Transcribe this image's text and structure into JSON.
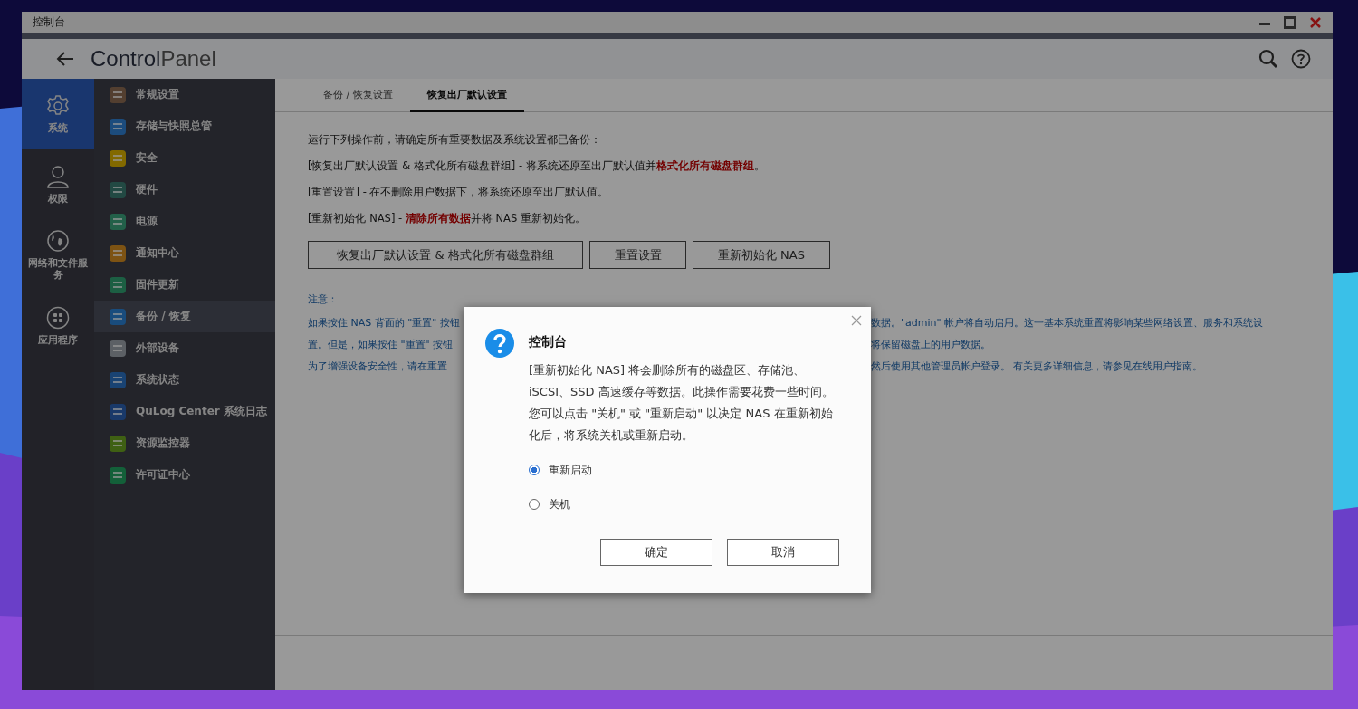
{
  "window": {
    "title": "控制台"
  },
  "header": {
    "title_bold": "Control",
    "title_light": "Panel"
  },
  "rail": [
    {
      "label": "系统",
      "selected": true
    },
    {
      "label": "权限",
      "selected": false
    },
    {
      "label": "网络和文件服务",
      "selected": false
    },
    {
      "label": "应用程序",
      "selected": false
    }
  ],
  "menu": [
    {
      "label": "常规设置",
      "selected": false
    },
    {
      "label": "存储与快照总管",
      "selected": false
    },
    {
      "label": "安全",
      "selected": false
    },
    {
      "label": "硬件",
      "selected": false
    },
    {
      "label": "电源",
      "selected": false
    },
    {
      "label": "通知中心",
      "selected": false
    },
    {
      "label": "固件更新",
      "selected": false
    },
    {
      "label": "备份 / 恢复",
      "selected": true
    },
    {
      "label": "外部设备",
      "selected": false
    },
    {
      "label": "系统状态",
      "selected": false
    },
    {
      "label": "QuLog Center 系统日志",
      "selected": false
    },
    {
      "label": "资源监控器",
      "selected": false
    },
    {
      "label": "许可证中心",
      "selected": false
    }
  ],
  "tabs": [
    {
      "label": "备份 / 恢复设置",
      "selected": false
    },
    {
      "label": "恢复出厂默认设置",
      "selected": true
    }
  ],
  "intro": [
    "运行下列操作前，请确定所有重要数据及系统设置都已备份：",
    "[恢复出厂默认设置 & 格式化所有磁盘群组] - 将系统还原至出厂默认值并**格式化所有磁盘群组**。",
    "[重置设置] - 在不删除用户数据下，将系统还原至出厂默认值。",
    "[重新初始化 NAS] - **清除所有数据**并将 NAS 重新初始化。"
  ],
  "actions": [
    "恢复出厂默认设置 & 格式化所有磁盘群组",
    "重置设置",
    "重新初始化 NAS"
  ],
  "notes": {
    "heading": "注意：",
    "lines": [
      {
        "left": "如果按住 NAS 背面的 \"重置\" 按钮",
        "right": "数据。\"admin\" 帐户将自动启用。这一基本系统重置将影响某些网络设置、服务和系统设"
      },
      {
        "left": "置。但是，如果按住 \"重置\" 按钮",
        "right": "将保留磁盘上的用户数据。"
      },
      {
        "left": "为了增强设备安全性，请在重置",
        "right": "然后使用其他管理员帐户登录。 有关更多详细信息，请参见在线用户指南。"
      }
    ]
  },
  "dialog": {
    "title": "控制台",
    "message": "[重新初始化 NAS] 将会删除所有的磁盘区、存储池、iSCSI、SSD 高速缓存等数据。此操作需要花费一些时间。您可以点击 \"关机\" 或 \"重新启动\" 以决定 NAS 在重新初始化后，将系统关机或重新启动。",
    "options": [
      {
        "label": "重新启动",
        "selected": true
      },
      {
        "label": "关机",
        "selected": false
      }
    ],
    "buttons": [
      "确定",
      "取消"
    ]
  }
}
